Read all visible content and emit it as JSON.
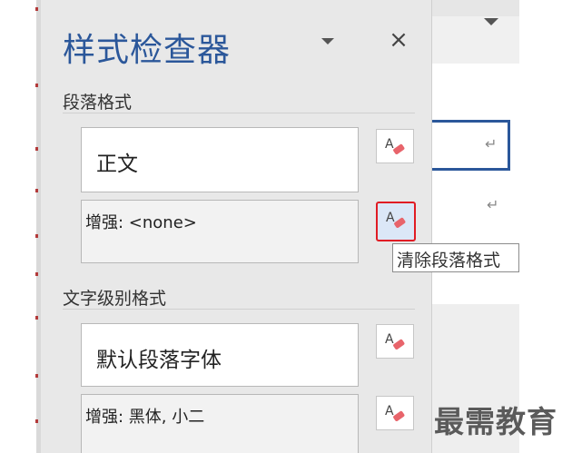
{
  "pane": {
    "title": "样式检查器",
    "close_glyph": "×"
  },
  "paragraph_section": {
    "header": "段落格式",
    "style_name": "正文",
    "enhancement": "增强: <none>"
  },
  "text_level_section": {
    "header": "文字级别格式",
    "style_name": "默认段落字体",
    "enhancement": "增强: 黑体, 小二"
  },
  "tooltip": {
    "text": "清除段落格式"
  },
  "document": {
    "paragraph_mark": "↵"
  },
  "watermark": {
    "text": "最需教育"
  },
  "icons": {
    "clear_format": "clear-formatting-eraser-icon"
  },
  "colors": {
    "title_blue": "#2b579a",
    "highlight_red": "#e01c24",
    "eraser_pink": "#e8646b"
  }
}
